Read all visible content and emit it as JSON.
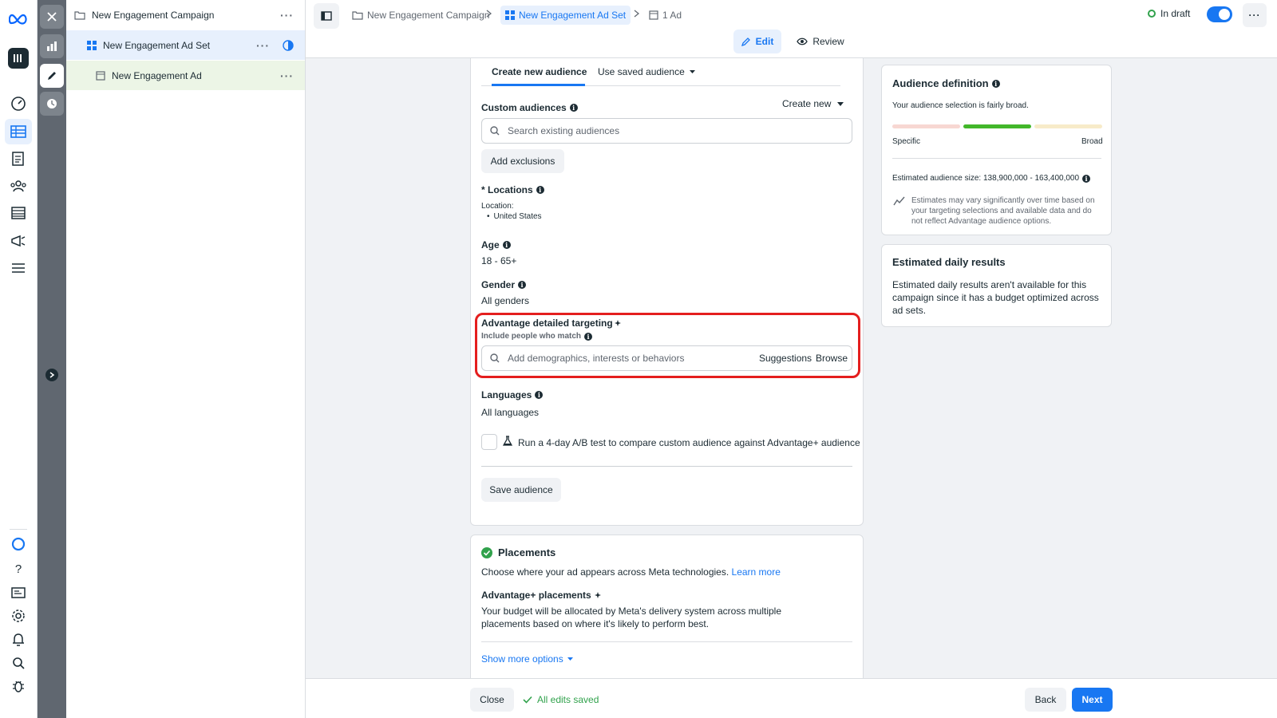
{
  "breadcrumbs": {
    "campaign": "New Engagement Campaign",
    "adset": "New Engagement Ad Set",
    "ad": "1 Ad"
  },
  "status": {
    "draft_label": "In draft",
    "toggle_on": true
  },
  "modes": {
    "edit": "Edit",
    "review": "Review"
  },
  "tree": {
    "campaign": "New Engagement Campaign",
    "adset": "New Engagement Ad Set",
    "ad": "New Engagement Ad"
  },
  "audience": {
    "tabs": [
      "Create new audience",
      "Use saved audience"
    ],
    "custom_audiences_label": "Custom audiences",
    "create_new": "Create new",
    "search_placeholder": "Search existing audiences",
    "add_exclusions": "Add exclusions",
    "locations_label": "* Locations",
    "location_sub": "Location:",
    "location_value": "United States",
    "age_label": "Age",
    "age_value": "18 - 65+",
    "gender_label": "Gender",
    "gender_value": "All genders",
    "targeting_label": "Advantage detailed targeting",
    "targeting_sub": "Include people who match",
    "targeting_placeholder": "Add demographics, interests or behaviors",
    "suggestions": "Suggestions",
    "browse": "Browse",
    "languages_label": "Languages",
    "languages_value": "All languages",
    "ab_test": "Run a 4-day A/B test to compare custom audience against Advantage+ audience",
    "save_audience": "Save audience"
  },
  "placements": {
    "title": "Placements",
    "desc": "Choose where your ad appears across Meta technologies.",
    "learn_more": "Learn more",
    "advantage_label": "Advantage+ placements",
    "advantage_desc_1": "Your budget will be allocated by Meta's delivery system across multiple",
    "advantage_desc_2": "placements based on where it's likely to perform best.",
    "show_more": "Show more options"
  },
  "definition": {
    "title": "Audience definition",
    "breadth_text": "Your audience selection is fairly broad.",
    "specific": "Specific",
    "broad": "Broad",
    "size": "Estimated audience size: 138,900,000 - 163,400,000",
    "note_1": "Estimates may vary significantly over time based on",
    "note_2": "your targeting selections and available data and do",
    "note_3": "not reflect Advantage audience options."
  },
  "daily": {
    "title": "Estimated daily results",
    "line_1": "Estimated daily results aren't available for this",
    "line_2": "campaign since it has a budget optimized across",
    "line_3": "ad sets."
  },
  "bottom": {
    "close": "Close",
    "saved": "All edits saved",
    "back": "Back",
    "next": "Next"
  },
  "colors": {
    "accent": "#1877f2",
    "highlight_box": "#e41e1e",
    "success": "#31a24c"
  }
}
